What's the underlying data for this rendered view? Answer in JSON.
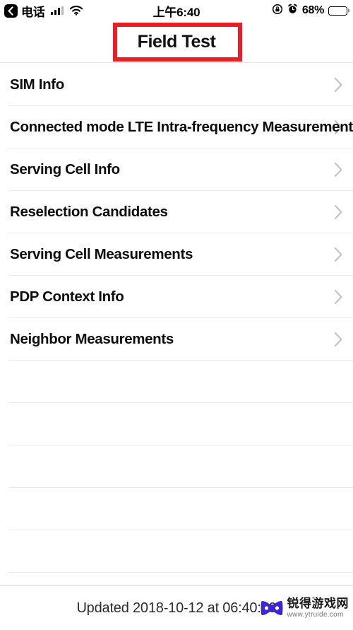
{
  "status_bar": {
    "back_icon": "back-chevron-icon",
    "carrier_label": "电话",
    "signal_icon": "cellular-signal-icon",
    "wifi_icon": "wifi-icon",
    "time": "上午6:40",
    "rotation_lock_icon": "rotation-lock-icon",
    "alarm_icon": "alarm-clock-icon",
    "battery_percent": "68%",
    "battery_icon": "battery-icon",
    "battery_level": 68
  },
  "nav": {
    "title": "Field Test",
    "highlight_color": "#ee1c25"
  },
  "list": {
    "chevron_icon": "chevron-right-icon",
    "items": [
      {
        "label": "SIM Info",
        "overflowing": false
      },
      {
        "label": "Connected mode LTE Intra-frequency Measurement",
        "overflowing": true
      },
      {
        "label": "Serving Cell Info",
        "overflowing": false
      },
      {
        "label": "Reselection Candidates",
        "overflowing": false
      },
      {
        "label": "Serving Cell Measurements",
        "overflowing": false
      },
      {
        "label": "PDP Context Info",
        "overflowing": false
      },
      {
        "label": "Neighbor Measurements",
        "overflowing": false
      }
    ],
    "empty_row_count": 6
  },
  "footer": {
    "updated_text": "Updated 2018-10-12 at 06:40:59",
    "watermark": {
      "icon": "gamepad-icon",
      "name": "锐得游戏网",
      "url": "www.ytruide.com",
      "color": "#3b28cc"
    }
  }
}
